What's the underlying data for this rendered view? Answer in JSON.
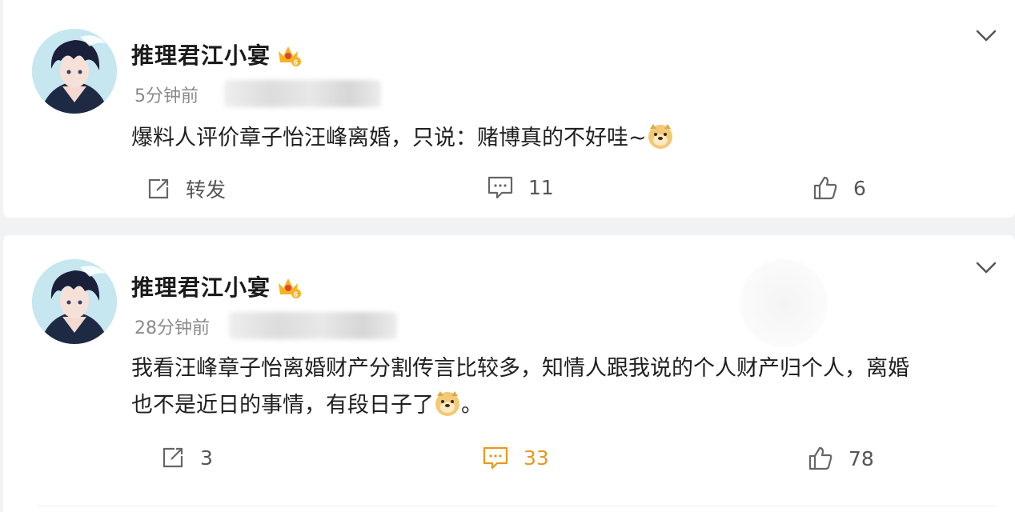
{
  "posts": [
    {
      "author": "推理君江小宴",
      "time": "5分钟前",
      "content": "爆料人评价章子怡汪峰离婚，只说：赌博真的不好哇~",
      "actions": {
        "repost": "转发",
        "comments": "11",
        "likes": "6"
      },
      "comment_active": false
    },
    {
      "author": "推理君江小宴",
      "time": "28分钟前",
      "content_line1": "我看汪峰章子怡离婚财产分割传言比较多，知情人跟我说的个人财产归个人，离婚",
      "content_line2": "也不是近日的事情，有段日子了",
      "content_end": "。",
      "actions": {
        "repost": "3",
        "comments": "33",
        "likes": "78"
      },
      "comment_active": true
    }
  ],
  "colors": {
    "accent": "#e69a1c",
    "badge": "#f5b324",
    "text": "#1f1f1f",
    "muted": "#8a8a8a"
  },
  "icons": [
    "chevron-down-icon",
    "repost-icon",
    "comment-icon",
    "like-icon",
    "vip-crown-badge-icon",
    "doge-emoji-icon"
  ]
}
